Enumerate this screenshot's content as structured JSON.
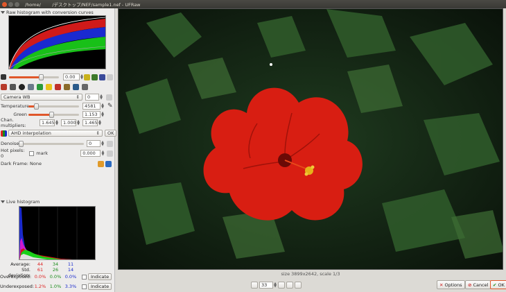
{
  "window": {
    "title": "/home/        /デスクトップ/NEF/sample1.nef - UFRaw"
  },
  "raw_histogram": {
    "title": "Raw histogram with conversion curves"
  },
  "exposure": {
    "value": "0.00"
  },
  "white_balance": {
    "preset": "Camera WB",
    "preset_spin": "0",
    "temperature_label": "Temperature",
    "temperature_value": "4581",
    "green_label": "Green",
    "green_value": "1.153",
    "chan_label": "Chan. multipliers:",
    "chan_r": "1.645",
    "chan_g": "1.000",
    "chan_b": "1.465"
  },
  "interpolation": {
    "label": "AHD interpolation",
    "ok": "OK"
  },
  "denoise": {
    "label": "Denoise",
    "value": "0"
  },
  "hot_pixels": {
    "label": "Hot pixels: 0",
    "mark": "mark",
    "value": "0.000"
  },
  "dark_frame": {
    "label": "Dark Frame: None"
  },
  "live_histogram": {
    "title": "Live histogram",
    "average_label": "Average:",
    "average_r": "44",
    "average_g": "34",
    "average_b": "11",
    "std_label": "Std. deviation:",
    "std_r": "61",
    "std_g": "26",
    "std_b": "14",
    "over_label": "Overexposed:",
    "over_r": "0.0%",
    "over_g": "0.0%",
    "over_b": "0.0%",
    "under_label": "Underexposed:",
    "under_r": "1.2%",
    "under_g": "1.0%",
    "under_b": "3.3%",
    "indicate": "Indicate"
  },
  "status": {
    "text": "size 3899x2642, scale 1/3"
  },
  "zoom": {
    "value": "33"
  },
  "buttons": {
    "options": "Options",
    "cancel": "Cancel",
    "ok": "OK"
  },
  "colors": {
    "accent": "#e0572a",
    "red": "#dd2222",
    "green": "#1a8a1a",
    "blue": "#1a2acc",
    "flower": "#d81e12",
    "foliage": "#1f3b1f"
  }
}
